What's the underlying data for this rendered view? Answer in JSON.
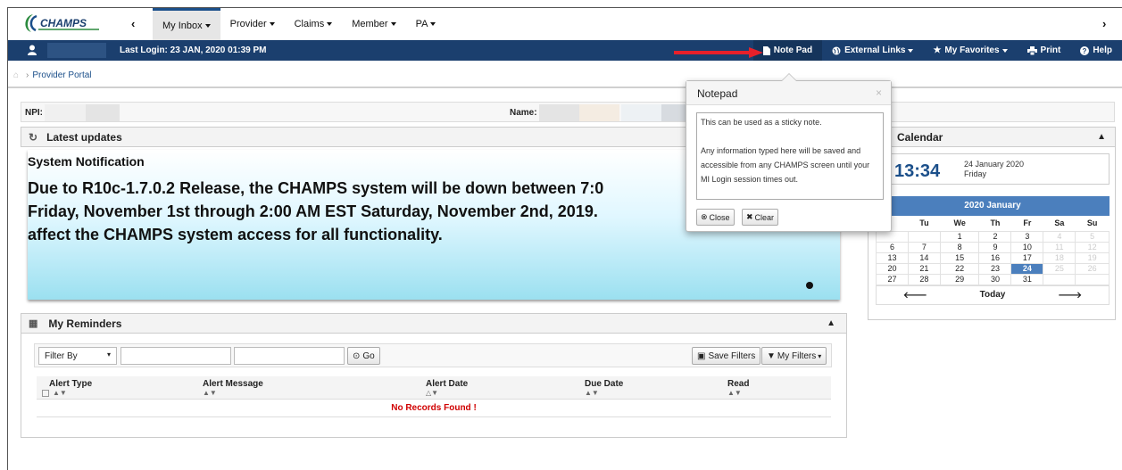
{
  "topnav": {
    "logo_text": "CHAMPS",
    "menus": [
      {
        "label": "My Inbox"
      },
      {
        "label": "Provider"
      },
      {
        "label": "Claims"
      },
      {
        "label": "Member"
      },
      {
        "label": "PA"
      }
    ]
  },
  "bluebar": {
    "last_login": "Last Login: 23 JAN, 2020 01:39 PM",
    "note_pad": "Note Pad",
    "external_links": "External Links",
    "my_favorites": "My Favorites",
    "print": "Print",
    "help": "Help"
  },
  "breadcrumb": {
    "item": "Provider Portal"
  },
  "npibar": {
    "npi_label": "NPI:",
    "name_label": "Name:"
  },
  "updates": {
    "title": "Latest updates",
    "system_notification": "System Notification",
    "message_lines": "Due to R10c-1.7.0.2 Release, the CHAMPS system will be down between 7:0\nFriday, November 1st through 2:00 AM EST Saturday, November 2nd, 2019.\naffect the CHAMPS system access for all functionality."
  },
  "reminders": {
    "title": "My Reminders",
    "filter_by": "Filter By",
    "go": "Go",
    "save_filters": "Save Filters",
    "my_filters": "My Filters",
    "columns": [
      "Alert Type",
      "Alert Message",
      "Alert Date",
      "Due Date",
      "Read"
    ],
    "no_records": "No Records Found !"
  },
  "calendar": {
    "title": "Calendar",
    "time": "13:34",
    "date": "24 January 2020",
    "weekday": "Friday",
    "month_label": "2020 January",
    "day_headers": [
      "Tu",
      "We",
      "Th",
      "Fr",
      "Sa",
      "Su"
    ],
    "weeks": [
      [
        "",
        "1",
        "2",
        "3",
        "4",
        "5"
      ],
      [
        "7",
        "8",
        "9",
        "10",
        "11",
        "12"
      ],
      [
        "14",
        "15",
        "16",
        "17",
        "18",
        "19"
      ],
      [
        "21",
        "22",
        "23",
        "24",
        "25",
        "26"
      ],
      [
        "28",
        "29",
        "30",
        "31",
        "",
        ""
      ]
    ],
    "mondays": [
      "",
      "6",
      "13",
      "20",
      "27"
    ],
    "today_label": "Today"
  },
  "notepad": {
    "title": "Notepad",
    "text": "This can be used as a sticky note.\n\nAny information typed here will be saved and accessible from any CHAMPS screen until your MI Login session times out.",
    "close": "Close",
    "clear": "Clear"
  },
  "colors": {
    "nav_blue": "#1b3f6e",
    "accent": "#4b7fbd",
    "error": "#d00000",
    "annotation_arrow": "#e8202a"
  }
}
